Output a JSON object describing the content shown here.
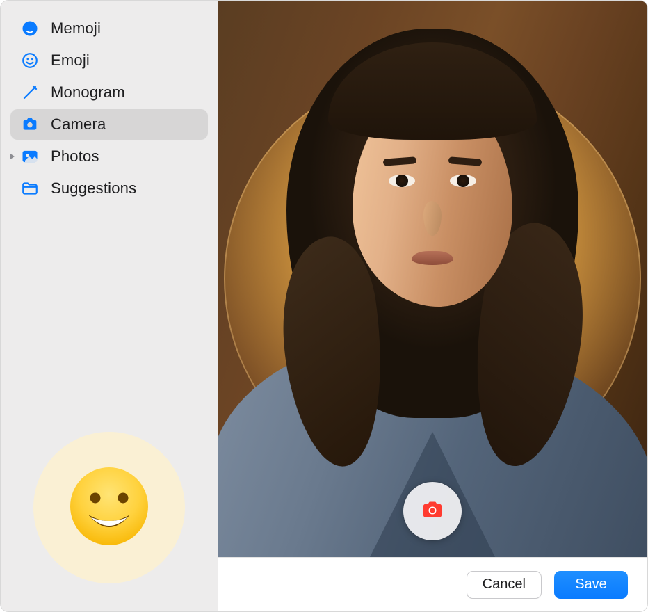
{
  "sidebar": {
    "items": [
      {
        "label": "Memoji",
        "icon": "memoji-face-icon",
        "selected": false
      },
      {
        "label": "Emoji",
        "icon": "emoji-smile-icon",
        "selected": false
      },
      {
        "label": "Monogram",
        "icon": "pencil-icon",
        "selected": false
      },
      {
        "label": "Camera",
        "icon": "camera-icon",
        "selected": true
      },
      {
        "label": "Photos",
        "icon": "photos-icon",
        "selected": false,
        "has_disclosure": true
      },
      {
        "label": "Suggestions",
        "icon": "folder-icon",
        "selected": false
      }
    ]
  },
  "current_avatar": {
    "emoji_name": "grinning-face"
  },
  "camera": {
    "shutter_icon": "camera-shutter-icon"
  },
  "footer": {
    "cancel_label": "Cancel",
    "save_label": "Save"
  },
  "colors": {
    "accent": "#0a7bff",
    "sidebar_bg": "#edecec",
    "sidebar_selected": "#d7d6d6",
    "icon_blue": "#0a7bff",
    "shutter_red": "#ff3b30"
  }
}
